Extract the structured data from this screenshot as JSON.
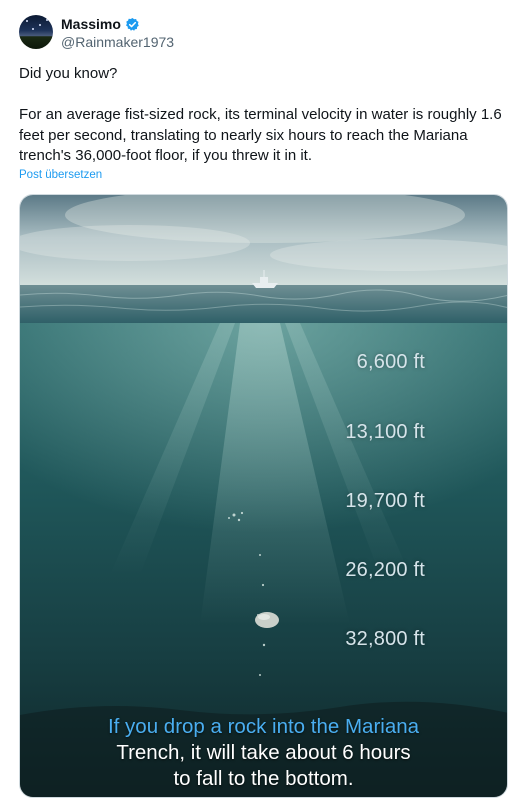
{
  "author": {
    "display_name": "Massimo",
    "handle": "@Rainmaker1973",
    "verified": true,
    "avatar_icon": "night-sky-avatar"
  },
  "post": {
    "line1": "Did you know?",
    "line2": "For an average fist-sized rock, its terminal velocity in water is roughly 1.6 feet per second, translating to nearly six hours to reach the Mariana trench's 36,000-foot floor, if you threw it in it.",
    "translate_link": "Post übersetzen"
  },
  "media": {
    "depth_labels": [
      "6,600 ft",
      "13,100 ft",
      "19,700 ft",
      "26,200 ft",
      "32,800 ft"
    ],
    "caption_line1": "If you drop a rock into the Mariana",
    "caption_line2": "Trench, it will take about 6 hours",
    "caption_line3": "to fall to the bottom."
  },
  "colors": {
    "link": "#1d9bf0",
    "verified_badge": "#1d9bf0",
    "caption_highlight": "#4aaef0",
    "water": "#1f5a5e"
  }
}
